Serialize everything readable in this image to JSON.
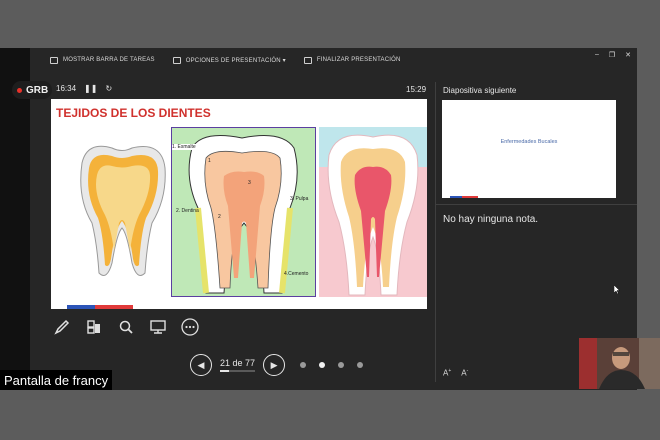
{
  "toolbar": {
    "taskbar_label": "MOSTRAR BARRA DE TAREAS",
    "options_label": "OPCIONES DE PRESENTACIÓN ▾",
    "end_label": "FINALIZAR PRESENTACIÓN"
  },
  "recording": {
    "label": "GRB"
  },
  "presenter": {
    "elapsed": "16:34",
    "clock": "15:29",
    "next_slide_label": "Diapositiva siguiente",
    "next_slide_title": "Enfermedades Bucales",
    "notes": "No hay ninguna nota.",
    "page_indicator": "21 de 77",
    "progress_fraction": 0.27
  },
  "slide": {
    "title": "TEJIDOS DE LOS DIENTES",
    "labels": [
      "1. Esmalte",
      "2. Dentina",
      "3. Pulpa",
      "4.Cemento",
      "1",
      "3",
      "2"
    ]
  },
  "participant": {
    "name_tag": "Pantalla de francy"
  },
  "colors": {
    "accent_red": "#d0312d",
    "bar_blue": "#2c55b8",
    "bar_red": "#e03a3a"
  },
  "icons": [
    "pen-icon",
    "slide-grid-icon",
    "zoom-icon",
    "screen-icon",
    "more-icon",
    "prev-icon",
    "next-icon"
  ]
}
